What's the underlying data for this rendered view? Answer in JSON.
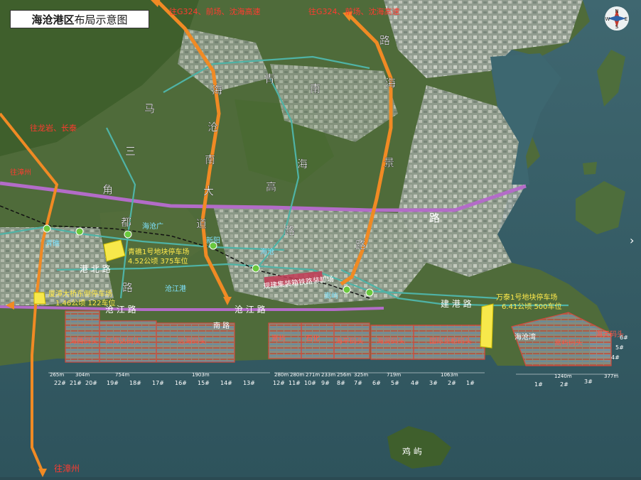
{
  "title": {
    "bold": "海沧港区",
    "rest": "布局示意图"
  },
  "compass": {
    "n": "N",
    "s": "S",
    "e": "E",
    "w": "W"
  },
  "directions": {
    "to_g324_left": "往G324、前场、沈海高速",
    "to_g324_right": "往G324、前场、沈海高速",
    "to_longyan": "往龙岩、长泰",
    "to_zhangzhou_west": "往漳州",
    "to_zhangzhou_south": "往漳州"
  },
  "road_chars": {
    "sanjiaomei": [
      "马",
      "三",
      "角",
      "都",
      "路"
    ],
    "nanhai": [
      "海",
      "沧",
      "南",
      "大",
      "道"
    ],
    "qingnan": [
      "青",
      "南",
      "海",
      "高",
      "路"
    ],
    "haijing": [
      "路",
      "海",
      "景",
      "路"
    ],
    "gangbei": "港 北 路",
    "canjiang": "沧 江 路",
    "jiangang": "建 港 路",
    "jiangnan": "南 路"
  },
  "areas": {
    "qinghu": "青礁",
    "xinyang": "新阳",
    "nanchang": "海沧广",
    "haicang": "海沧",
    "songyu": "嵩屿",
    "canjiang_port": "沧江港",
    "haicang_bay": "海沧湾",
    "gulangyu_link": "海沧",
    "jiyu": "鸡 屿"
  },
  "parking": {
    "qingtie": {
      "line1": "青礁1号地块停车场",
      "line2": "4.52公顷 375车位"
    },
    "xiadaqiao": {
      "line1": "厦漳大桥东侧停车场",
      "line2": "1.46公顷 122车位"
    },
    "zone2": {
      "line1": "万泰1号地块停车场",
      "line2": "6.41公顷 500车位"
    }
  },
  "rail_label": "规建集装箱铁路装卸场",
  "terminals": [
    {
      "name": "海腾码头"
    },
    {
      "name": "新海达码头"
    },
    {
      "name": "远海码头"
    },
    {
      "name": "嵩屿"
    },
    {
      "name": "石化"
    },
    {
      "name": "海平码头"
    },
    {
      "name": "海润码头"
    },
    {
      "name": "国际货柜码头"
    },
    {
      "name": "海天码头"
    },
    {
      "name": "嵩屿码头"
    }
  ],
  "lengths": [
    "265m",
    "304m",
    "754m",
    "1903m",
    "280m",
    "280m",
    "271m",
    "233m",
    "256m",
    "325m",
    "719m",
    "1063m",
    "1240m",
    "377m"
  ],
  "berths": [
    "22#",
    "21#",
    "20#",
    "19#",
    "18#",
    "17#",
    "16#",
    "15#",
    "14#",
    "13#",
    "12#",
    "11#",
    "10#",
    "9#",
    "8#",
    "7#",
    "6#",
    "5#",
    "4#",
    "3#",
    "2#",
    "1#",
    "1#",
    "2#",
    "3#",
    "4#",
    "5#",
    "6#"
  ]
}
